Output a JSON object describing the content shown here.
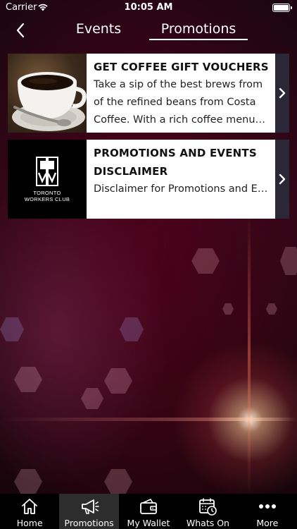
{
  "status_bar": {
    "carrier": "Carrier",
    "time": "10:05 AM"
  },
  "header": {
    "tabs": [
      {
        "label": "Events",
        "active": false
      },
      {
        "label": "Promotions",
        "active": true
      }
    ]
  },
  "promotions": [
    {
      "title": "GET COFFEE GIFT VOUCHERS",
      "description": "Take a sip of the best brews from of the refined beans from Costa Coffee. With a rich coffee menu and more",
      "image": "coffee-cup-image"
    },
    {
      "title": "PROMOTIONS AND EVENTS DISCLAIMER",
      "description": "Disclaimer for Promotions and Events",
      "image": "toronto-workers-club-logo",
      "logo_text": [
        "TORONTO",
        "WORKERS CLUB"
      ]
    }
  ],
  "tab_bar": {
    "items": [
      {
        "label": "Home",
        "icon": "home-icon",
        "active": false
      },
      {
        "label": "Promotions",
        "icon": "megaphone-icon",
        "active": true
      },
      {
        "label": "My Wallet",
        "icon": "wallet-icon",
        "active": false
      },
      {
        "label": "Whats On",
        "icon": "calendar-clock-icon",
        "active": false
      },
      {
        "label": "More",
        "icon": "more-dots-icon",
        "active": false
      }
    ]
  },
  "colors": {
    "card_arrow_bg": "#2b2736",
    "active_tab_bg": "#2d2d2d",
    "background_accent": "#2e0716"
  }
}
